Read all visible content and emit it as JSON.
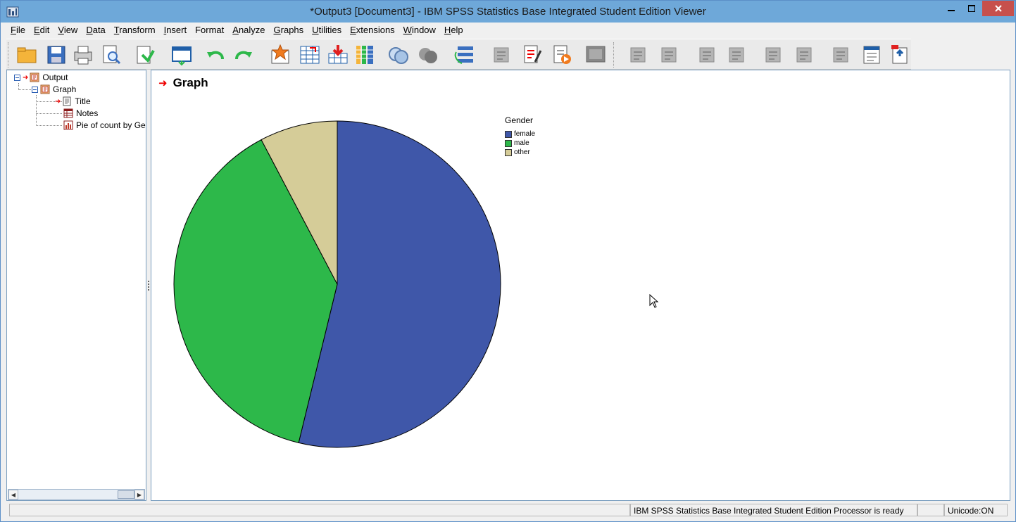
{
  "window": {
    "title": "*Output3 [Document3] - IBM SPSS Statistics Base Integrated Student Edition Viewer"
  },
  "menubar": {
    "items": [
      {
        "label": "File",
        "ul": "F",
        "rest": "ile"
      },
      {
        "label": "Edit",
        "ul": "E",
        "rest": "dit"
      },
      {
        "label": "View",
        "ul": "V",
        "rest": "iew"
      },
      {
        "label": "Data",
        "ul": "D",
        "rest": "ata"
      },
      {
        "label": "Transform",
        "ul": "T",
        "rest": "ransform"
      },
      {
        "label": "Insert",
        "ul": "I",
        "rest": "nsert"
      },
      {
        "label": "Format",
        "ul": "",
        "rest": "Format"
      },
      {
        "label": "Analyze",
        "ul": "A",
        "rest": "nalyze"
      },
      {
        "label": "Graphs",
        "ul": "G",
        "rest": "raphs"
      },
      {
        "label": "Utilities",
        "ul": "U",
        "rest": "tilities"
      },
      {
        "label": "Extensions",
        "ul": "E",
        "rest": "xtensions"
      },
      {
        "label": "Window",
        "ul": "W",
        "rest": "indow"
      },
      {
        "label": "Help",
        "ul": "H",
        "rest": "elp"
      }
    ]
  },
  "toolbar": {
    "icons": [
      "open-icon",
      "save-icon",
      "print-icon",
      "print-preview-icon",
      "export-icon",
      "recall-dialog-icon",
      "undo-icon",
      "redo-icon",
      "goto-data-icon",
      "goto-case-icon",
      "goto-variable-icon",
      "variables-icon",
      "designate-window-icon",
      "select-cases-icon",
      "pivot-icon",
      "output-bookmark-icon",
      "edit-icon",
      "insert-text-icon",
      "insert-chart-icon",
      "insert-table-icon",
      "promote-icon",
      "demote-icon",
      "expand-icon",
      "collapse-icon",
      "show-icon",
      "hide-icon",
      "insert-heading-icon",
      "insert-title-icon",
      "insert-page-icon"
    ]
  },
  "navigator": {
    "items": [
      {
        "label": "Output"
      },
      {
        "label": "Graph"
      },
      {
        "label": "Title"
      },
      {
        "label": "Notes"
      },
      {
        "label": "Pie of count by Ge"
      }
    ]
  },
  "content": {
    "header": "Graph"
  },
  "chart_data": {
    "type": "pie",
    "title": "",
    "legend_title": "Gender",
    "legend_position": "top-right",
    "categories": [
      "female",
      "male",
      "other"
    ],
    "values": [
      53.8,
      38.5,
      7.7
    ],
    "colors": [
      "#3f57a9",
      "#2db84a",
      "#d5cc98"
    ]
  },
  "statusbar": {
    "processor": "IBM SPSS Statistics Base Integrated Student Edition Processor is ready",
    "encoding": "Unicode:ON"
  }
}
